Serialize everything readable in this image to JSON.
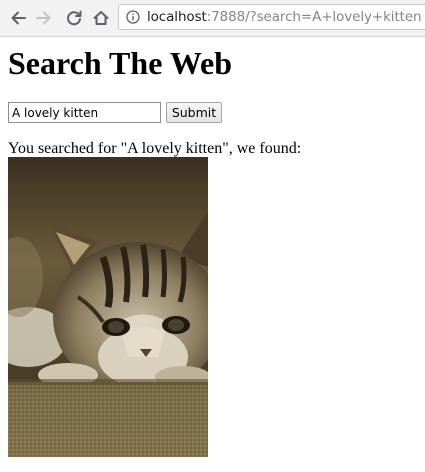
{
  "browser": {
    "url_host": "localhost",
    "url_rest": ":7888/?search=A+lovely+kitten",
    "back_icon": "back-arrow-icon",
    "forward_icon": "forward-arrow-icon",
    "reload_icon": "reload-icon",
    "home_icon": "home-icon",
    "info_icon": "info-icon"
  },
  "page": {
    "title": "Search The Web",
    "search_value": "A lovely kitten",
    "submit_label": "Submit",
    "result_text": "You searched for \"A lovely kitten\", we found:"
  },
  "colors": {
    "chrome_bg": "#f2f2f2",
    "icon_active": "#5f6368",
    "icon_disabled": "#c4c4c4"
  }
}
